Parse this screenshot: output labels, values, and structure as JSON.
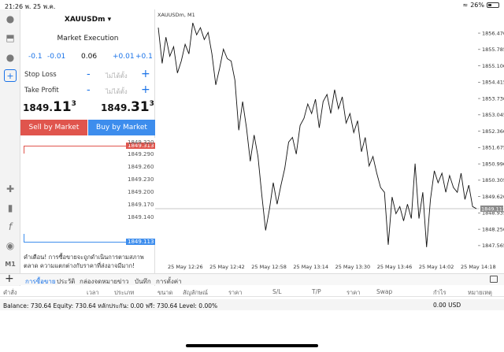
{
  "status_bar": {
    "time": "21:26",
    "date": "พ. 25 พ.ค.",
    "battery": "26%"
  },
  "left_rail": {
    "icons": [
      "person-icon",
      "deposit-icon",
      "chat-icon",
      "new-order-icon",
      "crosshair-icon",
      "candlestick-icon",
      "function-icon",
      "objects-icon"
    ],
    "timeframe": "M1"
  },
  "order_panel": {
    "symbol": "XAUUSDm",
    "execution": "Market Execution",
    "volume": {
      "minus_big": "-0.1",
      "minus_small": "-0.01",
      "value": "0.06",
      "plus_small": "+0.01",
      "plus_big": "+0.1"
    },
    "stop_loss": {
      "label": "Stop Loss",
      "value": "ไม่ได้ตั้ง"
    },
    "take_profit": {
      "label": "Take Profit",
      "value": "ไม่ได้ตั้ง"
    },
    "bid": {
      "prefix": "1849.",
      "big": "11",
      "sup": "3"
    },
    "ask": {
      "prefix": "1849.",
      "big": "31",
      "sup": "3"
    },
    "sell_label": "Sell by Market",
    "buy_label": "Buy by Market",
    "mini_chart": {
      "ticks": [
        "1849.320",
        "1849.290",
        "1849.260",
        "1849.230",
        "1849.200",
        "1849.170",
        "1849.140"
      ],
      "ask_badge": "1849.313",
      "bid_badge": "1849.113"
    },
    "warning": "คำเตือน! การซื้อขายจะถูกดำเนินการตามสภาพตลาด ความแตกต่างกับราคาที่ส่งอาจมีมาก!"
  },
  "chart_data": {
    "type": "line",
    "title": "XAUUSDm, M1",
    "y_ticks": [
      "1856.470",
      "1855.785",
      "1855.100",
      "1854.415",
      "1853.730",
      "1853.045",
      "1852.360",
      "1851.675",
      "1850.990",
      "1850.305",
      "1849.620",
      "1848.935",
      "1848.250",
      "1847.565"
    ],
    "ylim": [
      1847.0,
      1857.0
    ],
    "x_ticks": [
      "25 May 12:26",
      "25 May 12:42",
      "25 May 12:58",
      "25 May 13:14",
      "25 May 13:30",
      "25 May 13:46",
      "25 May 14:02",
      "25 May 14:18"
    ],
    "current_price": "1849.113",
    "current_value": 1849.113,
    "values": [
      1856.7,
      1855.2,
      1856.3,
      1855.5,
      1855.9,
      1854.8,
      1855.3,
      1856.0,
      1855.6,
      1856.9,
      1856.4,
      1856.7,
      1856.2,
      1856.5,
      1855.6,
      1854.3,
      1855.0,
      1855.8,
      1855.4,
      1855.3,
      1854.5,
      1852.4,
      1853.6,
      1852.5,
      1851.1,
      1852.2,
      1851.3,
      1849.7,
      1848.2,
      1849.1,
      1850.2,
      1849.3,
      1850.1,
      1850.8,
      1851.9,
      1852.1,
      1851.4,
      1852.6,
      1852.9,
      1853.5,
      1853.1,
      1853.7,
      1852.5,
      1853.6,
      1853.9,
      1853.1,
      1854.1,
      1853.3,
      1853.8,
      1852.7,
      1853.1,
      1852.3,
      1852.8,
      1851.5,
      1852.1,
      1850.9,
      1851.3,
      1850.6,
      1850.0,
      1849.8,
      1847.6,
      1849.6,
      1848.9,
      1849.2,
      1848.6,
      1849.3,
      1848.7,
      1851.0,
      1848.7,
      1849.8,
      1847.5,
      1849.5,
      1850.7,
      1850.2,
      1850.6,
      1849.8,
      1850.5,
      1850.0,
      1849.8,
      1850.6,
      1849.5,
      1850.1,
      1849.2,
      1849.113
    ]
  },
  "tabs": {
    "items": [
      "การซื้อขาย",
      "ประวัติ",
      "กล่องจดหมาย",
      "ข่าว",
      "บันทึก",
      "การตั้งค่า"
    ],
    "active": 0
  },
  "columns": [
    "คำสั่ง",
    "เวลา",
    "ประเภท",
    "ขนาด",
    "สัญลักษณ์",
    "ราคา",
    "S/L",
    "T/P",
    "ราคา",
    "Swap",
    "กำไร",
    "หมายเหตุ"
  ],
  "balance": {
    "text": "Balance: 730.64 Equity: 730.64 หลักประกัน: 0.00 ฟรี: 730.64 Level: 0.00%",
    "total": "0.00  USD"
  },
  "colors": {
    "sell": "#e0554d",
    "buy": "#3d8ded",
    "accent": "#1a73e8"
  }
}
